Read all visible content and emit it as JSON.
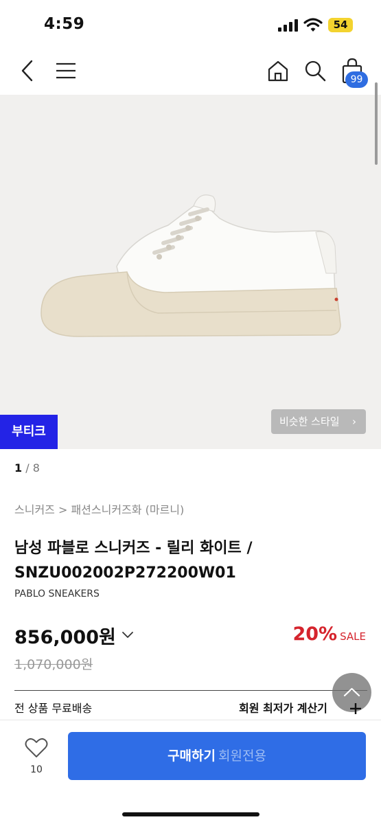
{
  "status_bar": {
    "time": "4:59",
    "battery": "54"
  },
  "header": {
    "cart_count": "99"
  },
  "icons": [
    "back-icon",
    "menu-icon",
    "home-icon",
    "search-icon",
    "bag-icon",
    "chevron-right-icon",
    "chevron-down-icon",
    "plus-icon",
    "chevron-up-icon",
    "heart-icon"
  ],
  "gallery": {
    "boutique_tag": "부티크",
    "similar_style": "비슷한 스타일",
    "current_page": "1",
    "total_pages": "/ 8"
  },
  "product": {
    "breadcrumb": "스니커즈 > 패션스니커즈화 (마르니)",
    "title": "남성 파블로 스니커즈 - 릴리 화이트 / SNZU002002P272200W01",
    "subtitle": "PABLO SNEAKERS",
    "price": "856,000원",
    "original_price": "1,070,000원",
    "discount_percent": "20%",
    "discount_label": "SALE"
  },
  "benefits": {
    "shipping": "전 상품 무료배송",
    "member_price": "회원 최저가 계산기"
  },
  "bottom_bar": {
    "like_count": "10",
    "buy_label": "구매하기",
    "buy_sub": "회원전용"
  },
  "colors": {
    "accent": "#2f6de6",
    "boutique": "#2323e6",
    "discount": "#d5242d"
  }
}
